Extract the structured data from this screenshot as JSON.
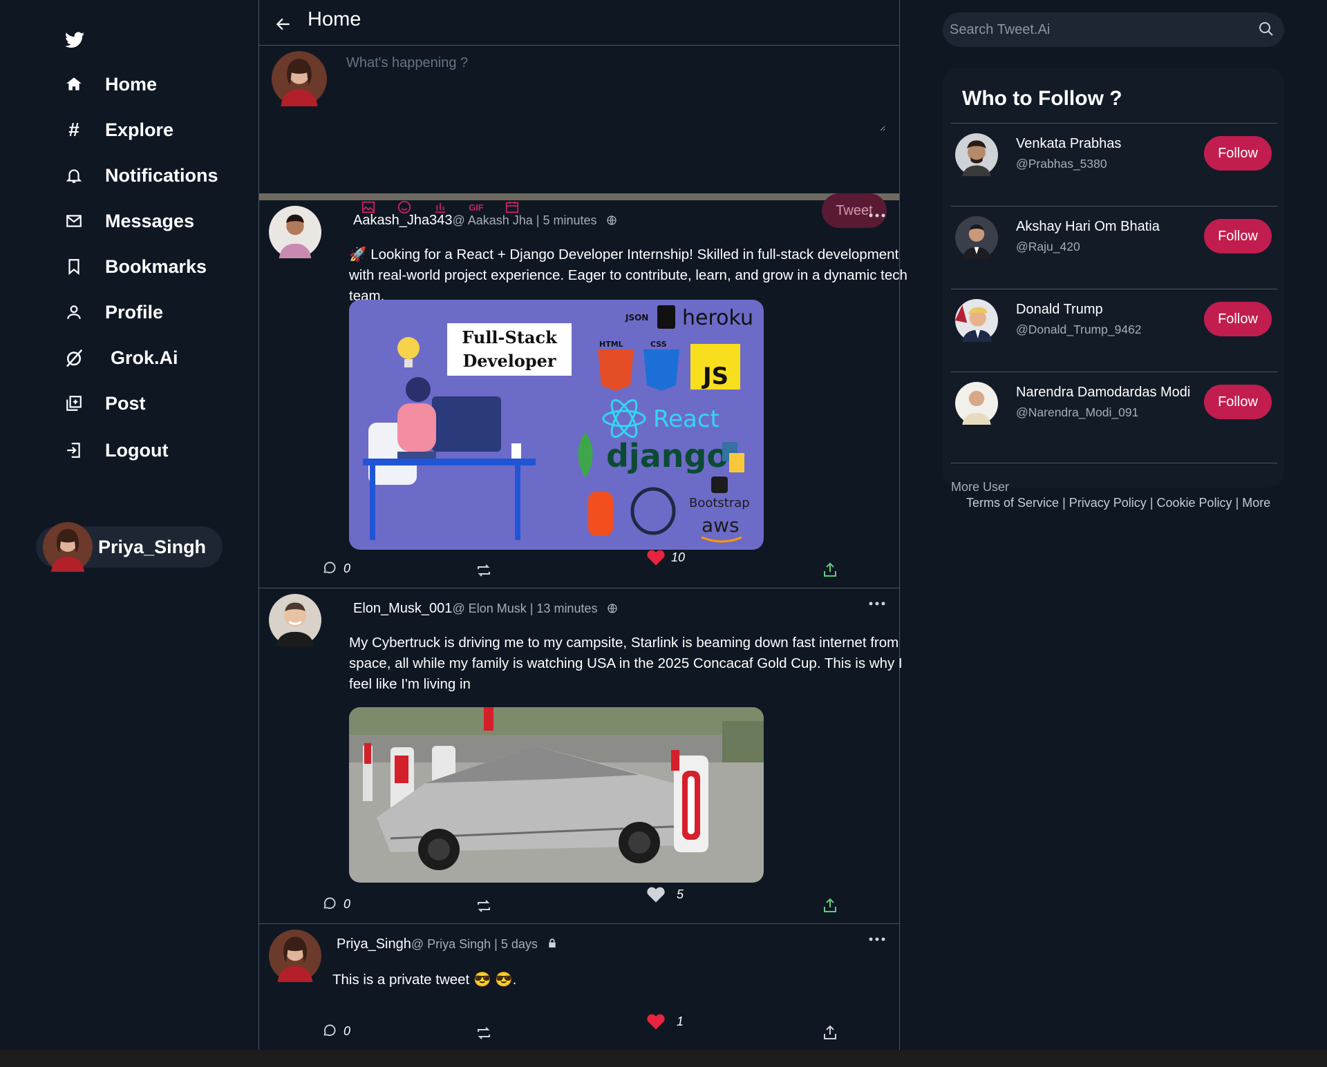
{
  "sidebar": {
    "nav": [
      {
        "label": "Home",
        "icon": "home-icon"
      },
      {
        "label": "Explore",
        "icon": "hashtag-icon"
      },
      {
        "label": "Notifications",
        "icon": "bell-icon"
      },
      {
        "label": "Messages",
        "icon": "mail-icon"
      },
      {
        "label": "Bookmarks",
        "icon": "bookmark-icon"
      },
      {
        "label": "Profile",
        "icon": "user-icon"
      },
      {
        "label": "Grok.Ai",
        "icon": "grok-icon"
      },
      {
        "label": "Post",
        "icon": "post-icon"
      },
      {
        "label": "Logout",
        "icon": "logout-icon"
      }
    ],
    "profile_name": "Priya_Singh"
  },
  "header": {
    "title": "Home"
  },
  "composer": {
    "placeholder": "What's happening ?",
    "tweet_label": "Tweet",
    "gif_label": "GIF"
  },
  "posts": [
    {
      "handle": "Aakash_Jha343",
      "meta": "@ Aakash Jha | 5 minutes",
      "text": "🚀 Looking for a React + Django Developer Internship! Skilled in full-stack development with real-world project experience. Eager to contribute, learn, and grow in a dynamic tech team.",
      "image_text": {
        "line1": "Full-Stack",
        "line2": "Developer",
        "heroku": "heroku",
        "react": "React",
        "django": "django",
        "bootstrap": "Bootstrap",
        "aws": "aws",
        "js": "JS",
        "html": "HTML",
        "css": "CSS",
        "json": "JSON"
      },
      "comments": "0",
      "likes": "10",
      "liked": true
    },
    {
      "handle": "Elon_Musk_001",
      "meta": "@ Elon Musk | 13 minutes",
      "text": "My Cybertruck is driving me to my campsite, Starlink is beaming down fast internet from space, all while my family is watching USA in the 2025 Concacaf Gold Cup. This is why I feel like I'm living in",
      "comments": "0",
      "likes": "5",
      "liked": false
    },
    {
      "handle": "Priya_Singh",
      "meta": "@ Priya Singh | 5 days",
      "text": "This is a private tweet 😎 😎.",
      "comments": "0",
      "likes": "1",
      "liked": true
    }
  ],
  "search": {
    "placeholder": "Search Tweet.Ai"
  },
  "who_to_follow": {
    "title": "Who to Follow ?",
    "users": [
      {
        "name": "Venkata Prabhas",
        "handle": "@Prabhas_5380",
        "button": "Follow"
      },
      {
        "name": "Akshay Hari Om Bhatia",
        "handle": "@Raju_420",
        "button": "Follow"
      },
      {
        "name": "Donald Trump",
        "handle": "@Donald_Trump_9462",
        "button": "Follow"
      },
      {
        "name": "Narendra Damodardas Modi",
        "handle": "@Narendra_Modi_091",
        "button": "Follow"
      }
    ],
    "more": "More User"
  },
  "footer": {
    "terms": "Terms of Service",
    "privacy": "Privacy Policy",
    "cookie": "Cookie Policy",
    "more": "More",
    "sep": "|"
  },
  "colors": {
    "background": "#0f1723",
    "accent": "#c21d4f",
    "like": "#e8243f",
    "share": "#5fd07a"
  }
}
